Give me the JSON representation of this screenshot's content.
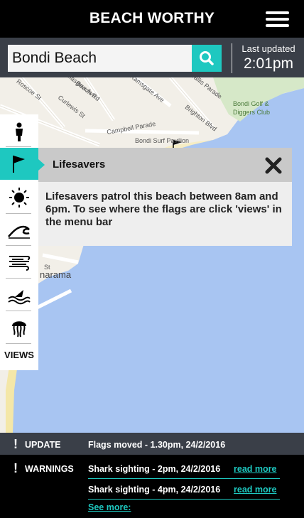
{
  "header": {
    "title": "BEACH WORTHY",
    "menu_icon": "hamburger-menu-icon"
  },
  "search": {
    "value": "Bondi Beach",
    "button_icon": "search-icon",
    "last_updated_label": "Last updated",
    "last_updated_time": "2:01pm"
  },
  "map": {
    "labels": [
      "Roscoe St",
      "Glasgow Ave",
      "Beach Rd",
      "Curlewis St",
      "Ramsgate Ave",
      "Wallis Parade",
      "Brighton Blvd",
      "Campbell Parade",
      "Bondi Surf Pavilion",
      "Bondi Golf &",
      "Diggers Club",
      "St",
      "narama"
    ],
    "water_color": "#a8c5f2",
    "land_color": "#f2efe8"
  },
  "rail": {
    "items": [
      {
        "name": "person",
        "icon": "person-icon"
      },
      {
        "name": "lifesavers",
        "icon": "flag-icon",
        "active": true
      },
      {
        "name": "uv",
        "icon": "sun-icon"
      },
      {
        "name": "waves",
        "icon": "wave-icon"
      },
      {
        "name": "wind",
        "icon": "wind-icon"
      },
      {
        "name": "sharks",
        "icon": "shark-icon"
      },
      {
        "name": "jellyfish",
        "icon": "jellyfish-icon"
      }
    ],
    "views_label": "VIEWS"
  },
  "popup": {
    "title": "Lifesavers",
    "body": "Lifesavers patrol this beach between 8am and 6pm. To see where the flags are click 'views' in the menu bar"
  },
  "updates": {
    "update_label": "UPDATE",
    "update_text": "Flags moved  - 1.30pm, 24/2/2016",
    "warnings_label": "WARNINGS",
    "warnings": [
      {
        "text": "Shark sighting  - 2pm, 24/2/2016",
        "link": "read more"
      },
      {
        "text": "Shark sighting  - 4pm, 24/2/2016",
        "link": "read more"
      }
    ],
    "see_more": "See more:",
    "accent": "#1ec8c0"
  }
}
